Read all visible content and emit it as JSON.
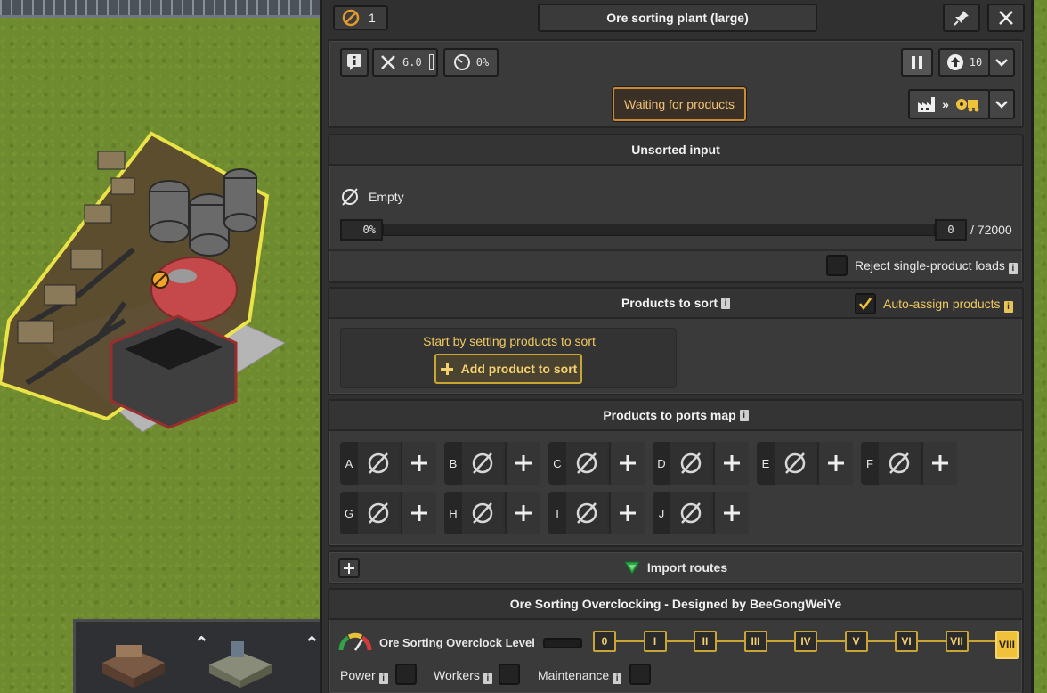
{
  "window": {
    "title": "Ore sorting plant (large)",
    "status_count": "1"
  },
  "header": {
    "workers_value": "6.0",
    "efficiency_value": "0%",
    "status_label": "Waiting for products",
    "priority_value": "10"
  },
  "unsorted_input": {
    "title": "Unsorted input",
    "empty_label": "Empty",
    "fill_percent": "0%",
    "fill_value": "0",
    "capacity": "/ 72000",
    "reject_label": "Reject single-product loads"
  },
  "products_to_sort": {
    "title": "Products to sort",
    "auto_assign_label": "Auto-assign products",
    "hint": "Start by setting products to sort",
    "add_button": "Add product to sort"
  },
  "ports_map": {
    "title": "Products to ports map",
    "ports": [
      "A",
      "B",
      "C",
      "D",
      "E",
      "F",
      "G",
      "H",
      "I",
      "J"
    ]
  },
  "import_routes": {
    "title": "Import routes"
  },
  "overclocking": {
    "title": "Ore Sorting Overclocking - Designed by BeeGongWeiYe",
    "level_label": "Ore Sorting Overclock Level",
    "levels": [
      "0",
      "I",
      "II",
      "III",
      "IV",
      "V",
      "VI",
      "VII",
      "VIII"
    ],
    "active_level": "VIII",
    "power_label": "Power",
    "workers_label": "Workers",
    "maintenance_label": "Maintenance"
  },
  "colors": {
    "accent": "#e8c35a",
    "panel": "#303030",
    "status_border": "#c98a3a"
  }
}
